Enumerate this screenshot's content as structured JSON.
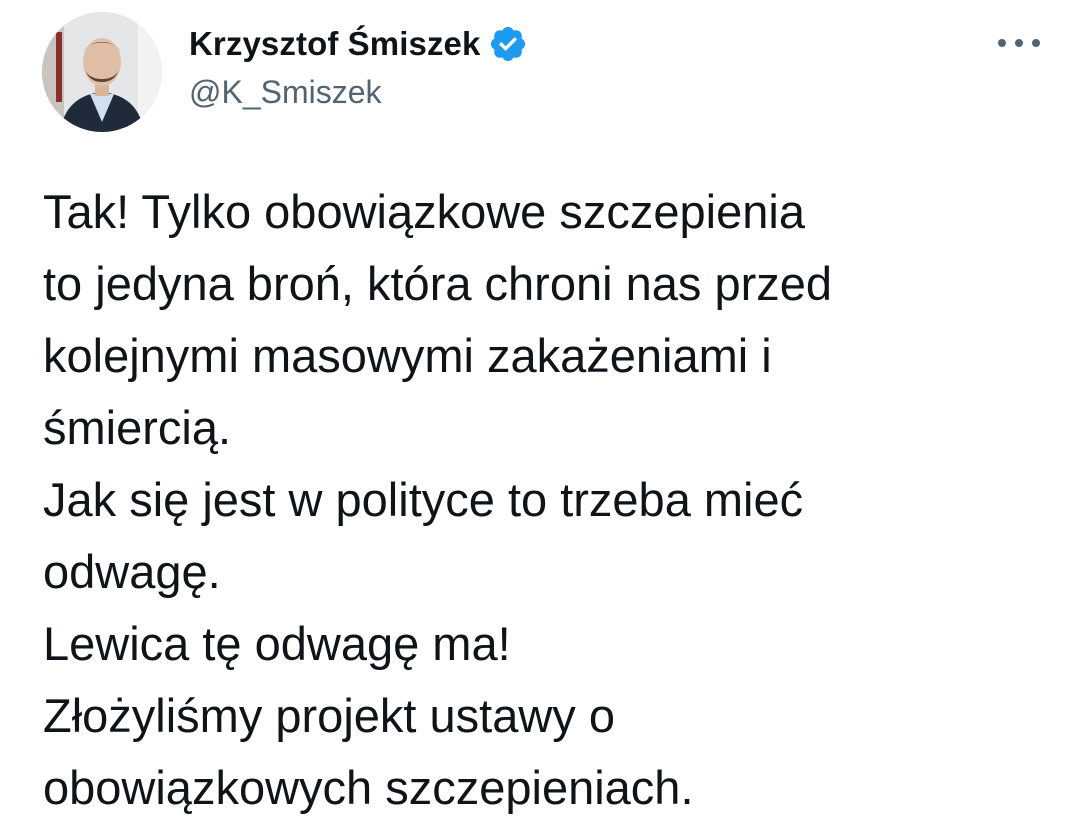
{
  "author": {
    "display_name": "Krzysztof Śmiszek",
    "handle": "@K_Smiszek",
    "verified": true,
    "avatar": "profile-photo"
  },
  "menu": {
    "icon": "more-horizontal-icon"
  },
  "tweet": {
    "lines": [
      "Tak! Tylko obowiązkowe szczepienia",
      "to jedyna broń, która chroni nas przed",
      "kolejnymi masowymi zakażeniami i",
      "śmiercią.",
      "Jak się jest w polityce to trzeba mieć",
      "odwagę.",
      "Lewica tę odwagę ma!",
      "Złożyliśmy projekt ustawy o",
      "obowiązkowych szczepieniach."
    ]
  },
  "colors": {
    "text": "#0f1419",
    "secondary": "#536471",
    "verified_blue": "#1d9bf0"
  }
}
